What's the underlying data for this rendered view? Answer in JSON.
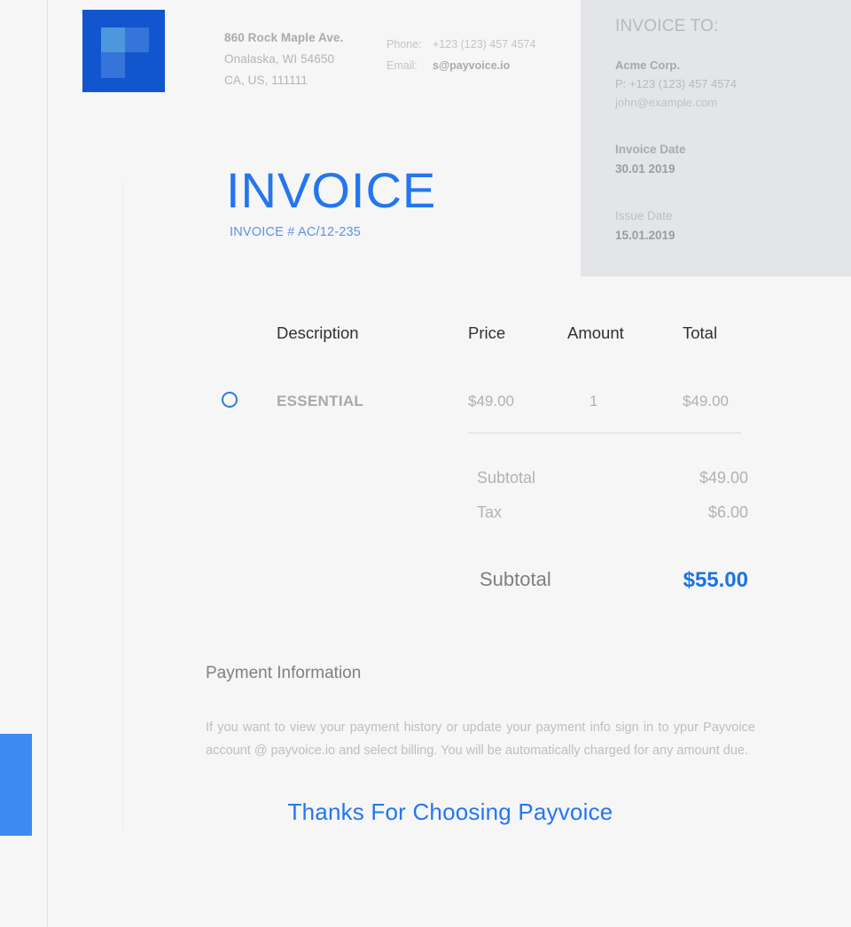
{
  "brand": {
    "logo_icon": "payvoice-logo-icon",
    "accent_blue": "#2476ef",
    "logo_blue": "#1156cf",
    "tab_blue": "#3d8bf2",
    "total_blue": "#1a73e8"
  },
  "company": {
    "address_line1": "860 Rock Maple Ave.",
    "address_line2": "Onalaska, WI 54650",
    "address_line3": "CA, US, 111111",
    "phone_label": "Phone:",
    "phone_value": "+123 (123) 457 4574",
    "email_label": "Email:",
    "email_value": "s@payvoice.io"
  },
  "invoice_to": {
    "title": "INVOICE TO:",
    "name": "Acme Corp.",
    "phone": "P: +123 (123) 457 4574",
    "email": "john@example.com"
  },
  "heading": {
    "title": "INVOICE",
    "number": "INVOICE # AC/12-235"
  },
  "dates": {
    "invoice_date_label": "Invoice Date",
    "invoice_date_value": "30.01 2019",
    "issue_date_label": "Issue Date",
    "issue_date_value": "15.01.2019"
  },
  "table": {
    "headers": {
      "description": "Description",
      "price": "Price",
      "amount": "Amount",
      "total": "Total"
    },
    "rows": [
      {
        "bullet_icon": "circle-outline-icon",
        "description": "ESSENTIAL",
        "price": "$49.00",
        "amount": "1",
        "total": "$49.00"
      }
    ]
  },
  "totals": {
    "subtotal_label": "Subtotal",
    "subtotal_value": "$49.00",
    "tax_label": "Tax",
    "tax_value": "$6.00",
    "grand_label": "Subtotal",
    "grand_value": "$55.00"
  },
  "payment": {
    "title": "Payment Information",
    "body": "If you want to view your payment history or update your payment info sign in to ypur Payvoice account @ payvoice.io and select billing. You will be automatically charged for any amount due."
  },
  "footer": {
    "thanks": "Thanks For Choosing Payvoice"
  }
}
